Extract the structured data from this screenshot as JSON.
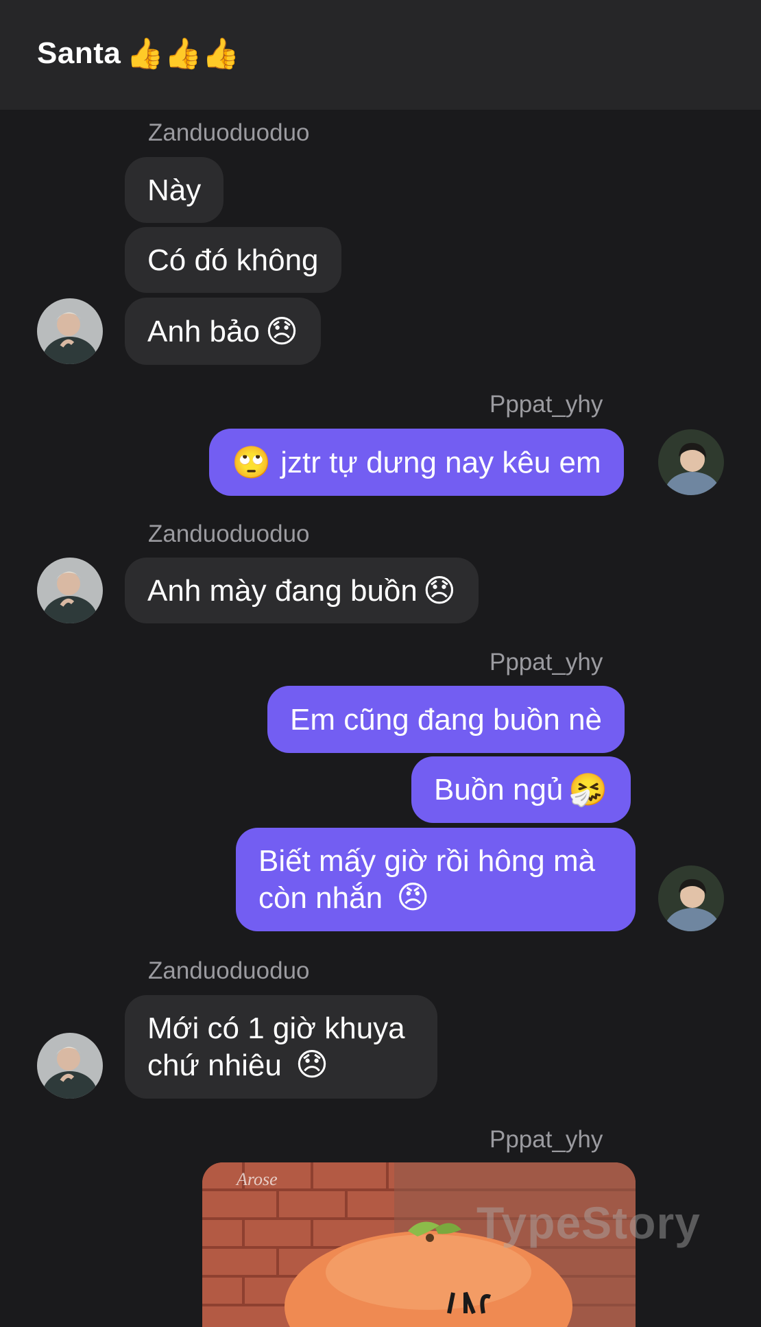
{
  "header": {
    "title": "Santa",
    "title_emoji": "👍👍👍"
  },
  "users": {
    "left": "Zanduoduoduo",
    "right": "Pppat_yhy"
  },
  "messages": [
    {
      "sender": "Zanduoduoduo",
      "text": "Này"
    },
    {
      "sender": "Zanduoduoduo",
      "text": "Có đó không"
    },
    {
      "sender": "Zanduoduoduo",
      "text": "Anh bảo",
      "emoji": "😞"
    },
    {
      "sender": "Pppat_yhy",
      "emoji_lead": "🙄",
      "text": "jztr tự dưng nay kêu em"
    },
    {
      "sender": "Zanduoduoduo",
      "text": "Anh mày đang buồn",
      "emoji": "😞"
    },
    {
      "sender": "Pppat_yhy",
      "text": "Em cũng đang buồn nè"
    },
    {
      "sender": "Pppat_yhy",
      "text": "Buồn ngủ",
      "emoji": "🤧"
    },
    {
      "sender": "Pppat_yhy",
      "text_line1": "Biết mấy giờ rồi hông mà",
      "text_line2": "còn nhắn",
      "emoji": "😠"
    },
    {
      "sender": "Zanduoduoduo",
      "text_line1": "Mới có 1 giờ khuya",
      "text_line2": "chứ nhiêu",
      "emoji": "😞"
    },
    {
      "sender": "Pppat_yhy",
      "type": "image",
      "caption_tag": "Arose"
    }
  ],
  "watermark": "TypeStory",
  "colors": {
    "background": "#1a1a1c",
    "header": "#262628",
    "incoming_bubble": "#2c2c2e",
    "outgoing_bubble": "#735ef2",
    "sender_name": "#9b9ba0"
  }
}
